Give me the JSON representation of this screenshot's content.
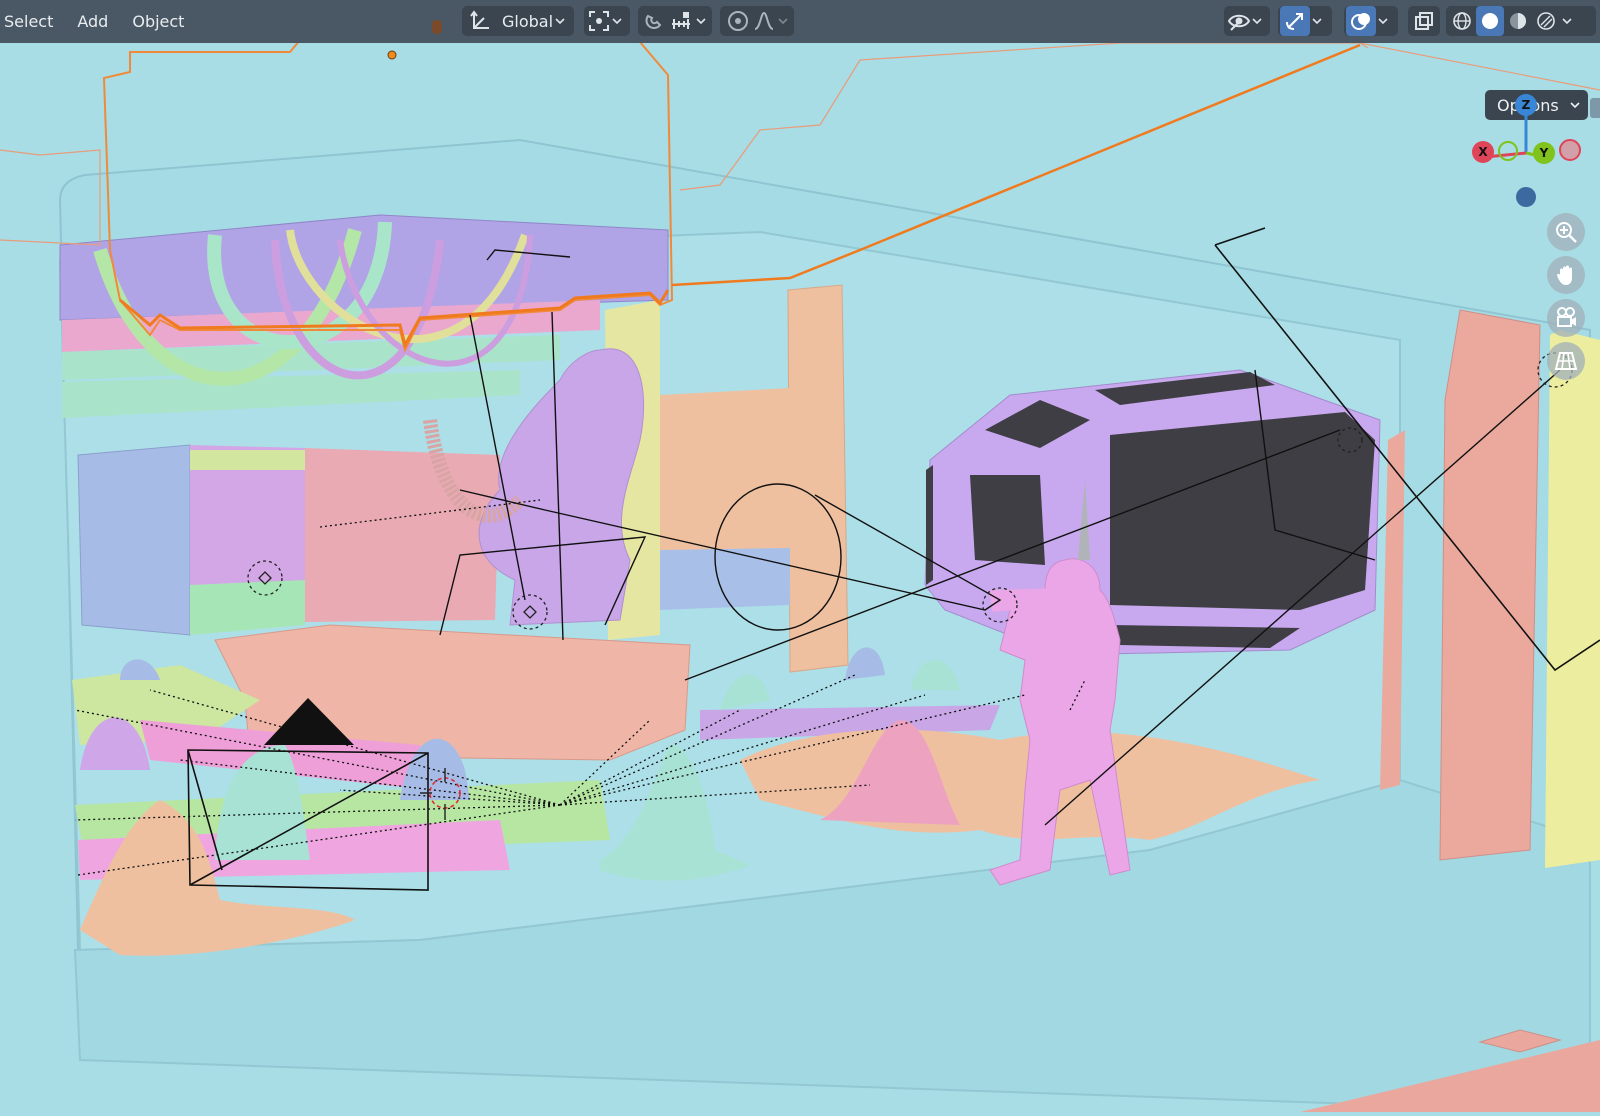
{
  "menu": {
    "select_label": "Select",
    "add_label": "Add",
    "object_label": "Object"
  },
  "toolbar": {
    "transform_orientation": "Global",
    "pivot_icon": "pivot-point-icon",
    "snap_icon": "snap-magnet-icon",
    "snap_increment_icon": "snap-increment-icon",
    "proportional_icon": "proportional-editing-icon",
    "falloff_icon": "falloff-curve-icon"
  },
  "header_right": {
    "visibility_icon": "eye-visibility-icon",
    "gizmo_icon": "gizmo-toggle-icon",
    "overlay_icon": "overlay-toggle-icon",
    "xray_icon": "xray-toggle-icon",
    "shading_modes": [
      "wireframe-icon",
      "solid-icon",
      "material-preview-icon",
      "rendered-icon"
    ],
    "active_shading": "solid"
  },
  "options": {
    "label": "Options"
  },
  "gizmo": {
    "z": "Z",
    "x": "X",
    "y": "Y"
  },
  "nav_buttons": [
    "zoom-icon",
    "hand-pan-icon",
    "camera-view-icon",
    "ortho-grid-icon"
  ],
  "colors": {
    "header_bg": "#4a5866",
    "viewport_bg": "#a8dde6",
    "accent": "#4a77b5",
    "axis_x": "#e04458",
    "axis_y": "#7fc31c",
    "axis_z": "#3a86d6",
    "selection_outline": "#f07a1e"
  }
}
